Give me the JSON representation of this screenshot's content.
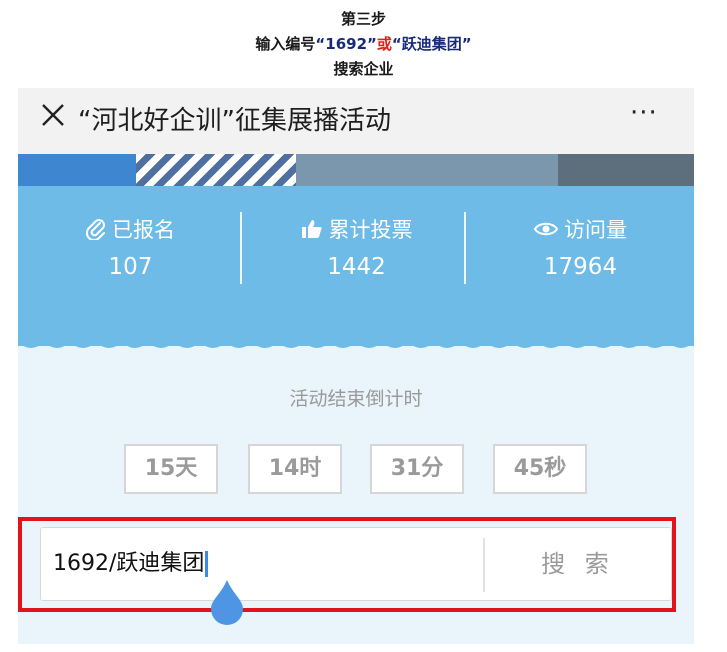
{
  "instructions": {
    "step": "第三步",
    "line2_prefix": "输入编号",
    "line2_code": "“1692”",
    "line2_or": "或",
    "line2_company": "“跃迪集团”",
    "line3": "搜索企业"
  },
  "header": {
    "title": "“河北好企训”征集展播活动",
    "more": "···"
  },
  "stats": [
    {
      "label": "已报名",
      "value": "107",
      "icon": "paperclip-icon"
    },
    {
      "label": "累计投票",
      "value": "1442",
      "icon": "thumbs-up-icon"
    },
    {
      "label": "访问量",
      "value": "17964",
      "icon": "eye-icon"
    }
  ],
  "countdown": {
    "label": "活动结束倒计时",
    "days": "15天",
    "hours": "14时",
    "minutes": "31分",
    "seconds": "45秒"
  },
  "search": {
    "value": "1692/跃迪集团",
    "button_label": "搜 索"
  },
  "colors": {
    "stats_bg": "#6dbbe6",
    "page_bg": "#e9f4fb",
    "highlight_frame": "#e0141c",
    "or_text": "#d8231f",
    "caret": "#3d8be0"
  }
}
